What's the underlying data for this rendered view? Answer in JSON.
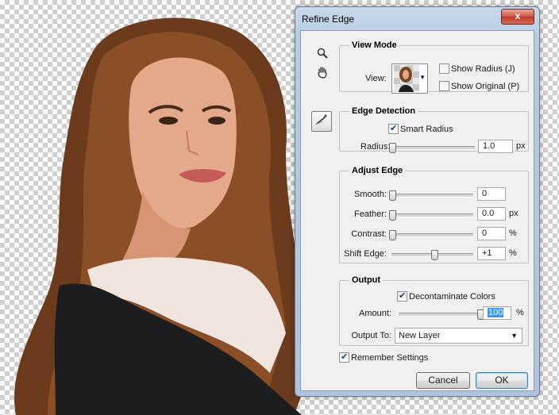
{
  "dialog": {
    "title": "Refine Edge",
    "close_glyph": "x"
  },
  "tools": {
    "zoom": "zoom-icon",
    "hand": "hand-icon",
    "refine": "refine-radius-brush-icon"
  },
  "view_mode": {
    "legend": "View Mode",
    "view_label": "View:",
    "show_radius": {
      "label": "Show Radius (J)",
      "checked": false
    },
    "show_original": {
      "label": "Show Original (P)",
      "checked": false
    }
  },
  "edge_detection": {
    "legend": "Edge Detection",
    "smart_radius": {
      "label": "Smart Radius",
      "checked": true
    },
    "radius": {
      "label": "Radius:",
      "value": "1.0",
      "unit": "px",
      "slider": 0.0
    }
  },
  "adjust_edge": {
    "legend": "Adjust Edge",
    "smooth": {
      "label": "Smooth:",
      "value": "0",
      "unit": "",
      "slider": 0.0
    },
    "feather": {
      "label": "Feather:",
      "value": "0.0",
      "unit": "px",
      "slider": 0.0
    },
    "contrast": {
      "label": "Contrast:",
      "value": "0",
      "unit": "%",
      "slider": 0.0
    },
    "shift_edge": {
      "label": "Shift Edge:",
      "value": "+1",
      "unit": "%",
      "slider": 0.51
    }
  },
  "output": {
    "legend": "Output",
    "decontaminate": {
      "label": "Decontaminate Colors",
      "checked": true
    },
    "amount": {
      "label": "Amount:",
      "value": "100",
      "unit": "%",
      "slider": 1.0
    },
    "output_to": {
      "label": "Output To:",
      "value": "New Layer"
    }
  },
  "remember_settings": {
    "label": "Remember Settings",
    "checked": true
  },
  "buttons": {
    "cancel": "Cancel",
    "ok": "OK"
  },
  "colors": {
    "dialog_frame": "#b7cbe2",
    "close_button": "#c0392b",
    "selection": "#3399ff"
  }
}
